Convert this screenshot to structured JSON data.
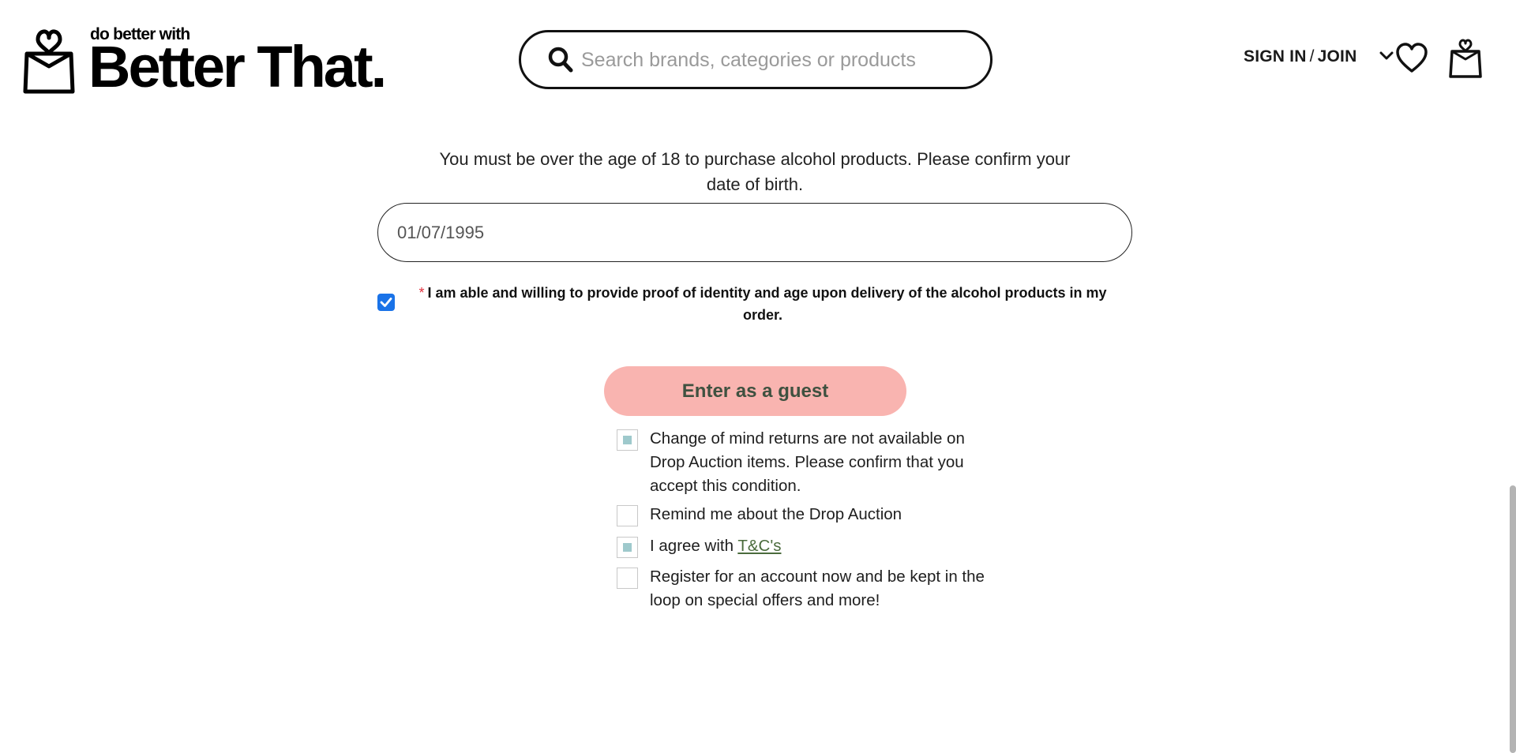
{
  "header": {
    "logo_tagline": "do better with",
    "logo_brand": "Better That.",
    "search_placeholder": "Search brands, categories or products",
    "search_value": "",
    "signin_label": "SIGN IN",
    "signin_separator": "/",
    "join_label": "JOIN"
  },
  "age_gate": {
    "message": "You must be over the age of 18 to purchase alcohol products. Please confirm your date of birth.",
    "dob_value": "01/07/1995",
    "proof_required_marker": "*",
    "proof_label": "I am able and willing to provide proof of identity and age upon delivery of the alcohol products in my order.",
    "proof_checked": true,
    "guest_button_label": "Enter as a guest"
  },
  "options": [
    {
      "label": "Change of mind returns are not available on Drop Auction items. Please confirm that you accept this condition.",
      "checked": true
    },
    {
      "label": "Remind me about the Drop Auction",
      "checked": false
    },
    {
      "label_prefix": "I agree with ",
      "link_text": "T&C's",
      "checked": true
    },
    {
      "label": "Register for an account now and be kept in the loop on special offers and more!",
      "checked": false
    }
  ],
  "colors": {
    "guest_button_bg": "#f9b4b0",
    "guest_button_text": "#3f5140",
    "checkbox_fill": "#9ec9cc",
    "required_star": "#e0303c",
    "link": "#4a6b3c",
    "native_checkbox": "#1a73e8"
  },
  "icons": [
    "bag-logo-icon",
    "search-icon",
    "chevron-down-icon",
    "heart-icon",
    "cart-bag-icon",
    "checkmark-icon"
  ]
}
